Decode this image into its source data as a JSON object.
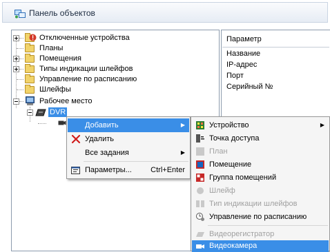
{
  "window": {
    "title": "Панель объектов"
  },
  "tree": {
    "items": [
      {
        "label": "Отключенные устройства"
      },
      {
        "label": "Планы"
      },
      {
        "label": "Помещения"
      },
      {
        "label": "Типы индикации шлейфов"
      },
      {
        "label": "Управление по расписанию"
      },
      {
        "label": "Шлейфы"
      },
      {
        "label": "Рабочее место"
      },
      {
        "label": "DVR"
      }
    ]
  },
  "properties": {
    "header": "Параметр",
    "rows": [
      "Название",
      "IP-адрес",
      "Порт",
      "Серийный №"
    ]
  },
  "context_menu": {
    "add": "Добавить",
    "delete": "Удалить",
    "all_tasks": "Все задания",
    "params": "Параметры...",
    "params_shortcut": "Ctrl+Enter"
  },
  "submenu": {
    "items": [
      {
        "label": "Устройство",
        "enabled": true
      },
      {
        "label": "Точка доступа",
        "enabled": true
      },
      {
        "label": "План",
        "enabled": false
      },
      {
        "label": "Помещение",
        "enabled": true
      },
      {
        "label": "Группа помещений",
        "enabled": true
      },
      {
        "label": "Шлейф",
        "enabled": false
      },
      {
        "label": "Тип индикации шлейфов",
        "enabled": false
      },
      {
        "label": "Управление по расписанию",
        "enabled": true
      },
      {
        "label": "Видеорегистратор",
        "enabled": false
      },
      {
        "label": "Видеокамера",
        "enabled": true,
        "highlighted": true
      }
    ]
  },
  "colors": {
    "highlight": "#3a8ee7",
    "title_text": "#1b2a3f"
  }
}
